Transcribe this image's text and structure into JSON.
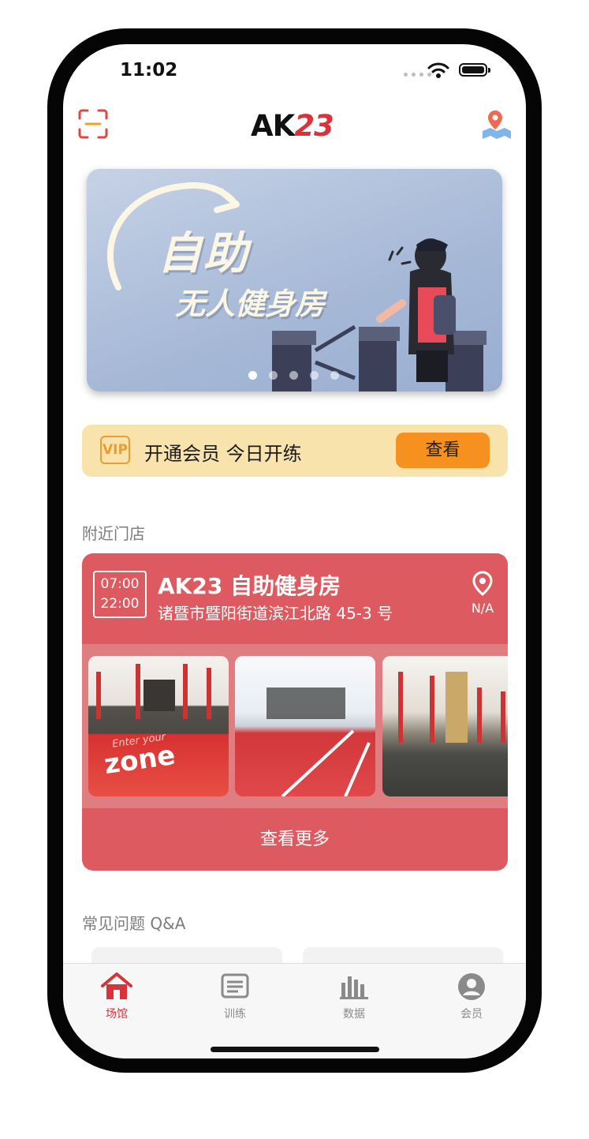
{
  "status_bar": {
    "time": "11:02"
  },
  "header": {
    "logo_prefix": "AK",
    "logo_number": "23"
  },
  "banner": {
    "title_line1": "自助",
    "title_line2": "无人健身房",
    "slide_count": 5,
    "active_slide": 1
  },
  "vip": {
    "badge": "VIP",
    "text": "开通会员 今日开练",
    "button": "查看"
  },
  "nearby": {
    "section_title": "附近门店",
    "store": {
      "open_time": "07:00",
      "close_time": "22:00",
      "name": "AK23 自助健身房",
      "address": "诸暨市暨阳街道滨江北路 45-3 号",
      "distance": "N/A",
      "mat_text_small": "Enter your",
      "mat_text_big": "zone",
      "more_button": "查看更多"
    }
  },
  "faq": {
    "section_title": "常见问题 Q&A"
  },
  "tabs": [
    {
      "label": "场馆",
      "icon": "home-icon",
      "active": true
    },
    {
      "label": "训练",
      "icon": "list-icon",
      "active": false
    },
    {
      "label": "数据",
      "icon": "bar-chart-icon",
      "active": false
    },
    {
      "label": "会员",
      "icon": "person-icon",
      "active": false
    }
  ],
  "colors": {
    "brand_red": "#d8323a",
    "card_red": "#dd5b60",
    "vip_bg": "#f9e3ad",
    "vip_button": "#f6911f"
  }
}
